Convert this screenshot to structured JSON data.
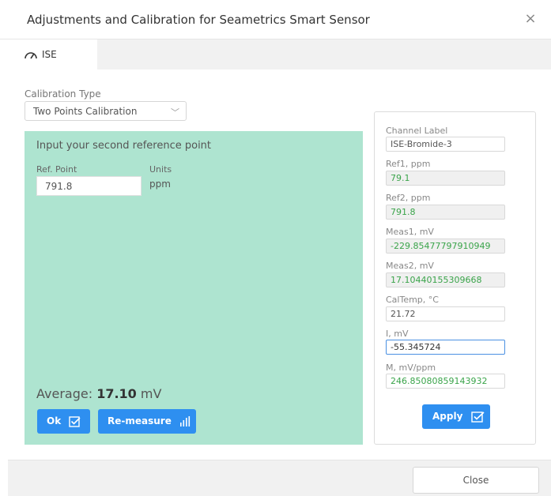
{
  "dialog": {
    "title": "Adjustments and Calibration for Seametrics Smart Sensor",
    "close_glyph": "×"
  },
  "tabs": [
    {
      "label": "ISE",
      "icon": "gauge-icon",
      "active": true
    }
  ],
  "calibration": {
    "type_label": "Calibration Type",
    "type_value": "Two Points Calibration"
  },
  "reference": {
    "instruction": "Input your second reference point",
    "ref_point_label": "Ref. Point",
    "ref_point_value": "791.8",
    "units_label": "Units",
    "units_value": "ppm",
    "average_label": "Average: ",
    "average_value": "17.10",
    "average_unit": " mV",
    "ok_label": "Ok",
    "remeasure_label": "Re-measure"
  },
  "channel": {
    "fields": [
      {
        "label": "Channel Label",
        "value": "ISE-Bromide-3"
      },
      {
        "label": "Ref1, ppm",
        "value": "79.1"
      },
      {
        "label": "Ref2, ppm",
        "value": "791.8"
      },
      {
        "label": "Meas1, mV",
        "value": "-229.85477797910949"
      },
      {
        "label": "Meas2, mV",
        "value": "17.10440155309668"
      },
      {
        "label": "CalTemp, °C",
        "value": "21.72"
      },
      {
        "label": "I, mV",
        "value": "-55.345724"
      },
      {
        "label": "M, mV/ppm",
        "value": "246.85080859143932"
      }
    ],
    "apply_label": "Apply"
  },
  "footer": {
    "close_label": "Close"
  },
  "colors": {
    "accent": "#2e8ff0",
    "panel_green": "#aee4d0",
    "value_green": "#3aa44a"
  }
}
